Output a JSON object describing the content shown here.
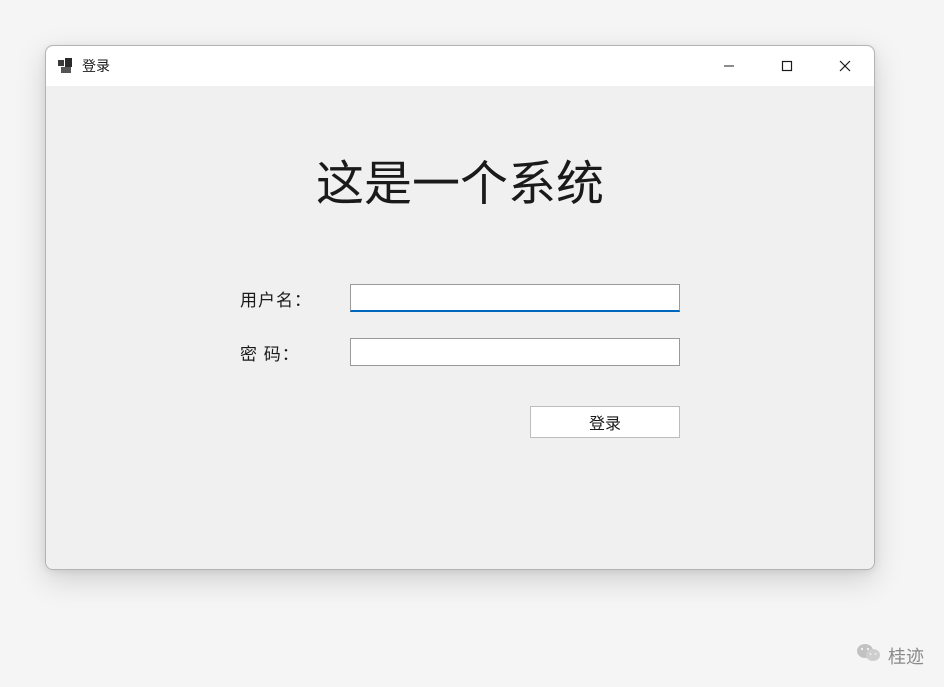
{
  "window": {
    "title": "登录"
  },
  "content": {
    "heading": "这是一个系统",
    "username_label": "用户名：",
    "password_label": "密  码：",
    "login_button": "登录",
    "username_value": "",
    "password_value": ""
  },
  "watermark": {
    "text": "桂迹"
  }
}
